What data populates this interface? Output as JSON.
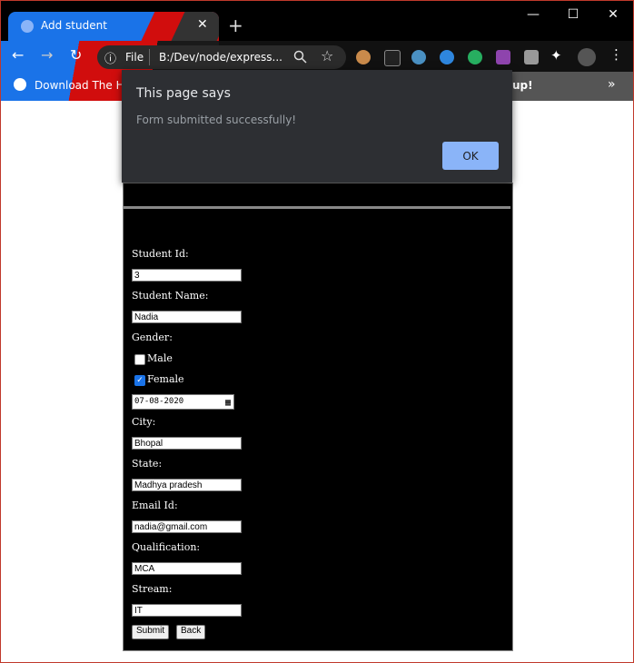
{
  "browser": {
    "tab_title": "Add student",
    "tab_close": "✕",
    "new_tab": "+",
    "window_controls": {
      "minimize": "—",
      "maximize": "☐",
      "close": "✕"
    },
    "nav": {
      "back": "←",
      "forward": "→",
      "reload": "↻"
    },
    "omnibox": {
      "info_icon": "ⓘ",
      "scheme_label": "File",
      "url": "B:/Dev/node/express..."
    },
    "bookmarks": {
      "first_item": "Download The Hin...",
      "right_fragment": "up!",
      "more": "»"
    }
  },
  "dialog": {
    "title": "This page says",
    "message": "Form submitted successfully!",
    "ok_label": "OK"
  },
  "form": {
    "student_id_label": "Student Id:",
    "student_id_value": "3",
    "student_name_label": "Student Name:",
    "student_name_value": "Nadia",
    "gender_label": "Gender:",
    "male_label": "Male",
    "male_checked": false,
    "female_label": "Female",
    "female_checked": true,
    "date_value": "07-08-2020",
    "city_label": "City:",
    "city_value": "Bhopal",
    "state_label": "State:",
    "state_value": "Madhya pradesh",
    "email_label": "Email Id:",
    "email_value": "nadia@gmail.com",
    "qualification_label": "Qualification:",
    "qualification_value": "MCA",
    "stream_label": "Stream:",
    "stream_value": "IT",
    "submit_label": "Submit",
    "back_label": "Back"
  },
  "colors": {
    "dialog_bg": "#2d2f33",
    "ok_button": "#8ab4f8",
    "page_bg": "#000000",
    "accent_red": "#d10d0d",
    "accent_blue": "#1a73e8"
  }
}
